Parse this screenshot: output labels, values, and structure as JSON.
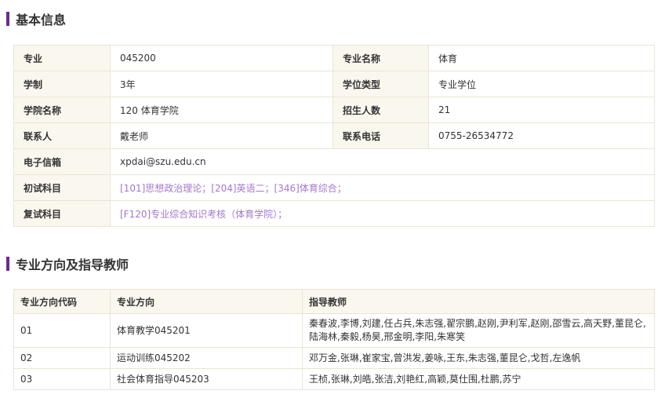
{
  "sections": {
    "basic_info_title": "基本信息",
    "directions_title": "专业方向及指导教师"
  },
  "info": {
    "major_code_label": "专业",
    "major_code": "045200",
    "major_name_label": "专业名称",
    "major_name": "体育",
    "duration_label": "学制",
    "duration": "3年",
    "degree_type_label": "学位类型",
    "degree_type": "专业学位",
    "college_label": "学院名称",
    "college": "120 体育学院",
    "enrollment_label": "招生人数",
    "enrollment": "21",
    "contact_label": "联系人",
    "contact": "戴老师",
    "phone_label": "联系电话",
    "phone": "0755-26534772",
    "email_label": "电子信箱",
    "email": "xpdai@szu.edu.cn",
    "first_exam_label": "初试科目",
    "first_exam": "[101]思想政治理论；[204]英语二；[346]体育综合；",
    "second_exam_label": "复试科目",
    "second_exam": "[F120]专业综合知识考核（体育学院）；"
  },
  "directions": {
    "headers": [
      "专业方向代码",
      "专业方向",
      "指导教师"
    ],
    "rows": [
      {
        "code": "01",
        "name": "体育教学045201",
        "teachers": "秦春波,李博,刘建,任占兵,朱志强,翟宗鹏,赵刚,尹利军,赵刚,邵雪云,高天野,董昆仑,陆海林,秦毅,杨昊,邢金明,李阳,朱寒笑"
      },
      {
        "code": "02",
        "name": "运动训练045202",
        "teachers": "邓万金,张琳,崔家宝,曾洪发,姜咏,王东,朱志强,董昆仑,戈哲,左逸帆"
      },
      {
        "code": "03",
        "name": "社会体育指导045203",
        "teachers": "王桢,张琳,刘皓,张洁,刘艳红,高颖,莫仕围,杜鹏,苏宁"
      }
    ]
  },
  "colors": {
    "accent_bar": "#6a2c8f",
    "link_purple": "#a379c9",
    "label_bg": "#faf8ee",
    "border": "#e8e4d6"
  }
}
